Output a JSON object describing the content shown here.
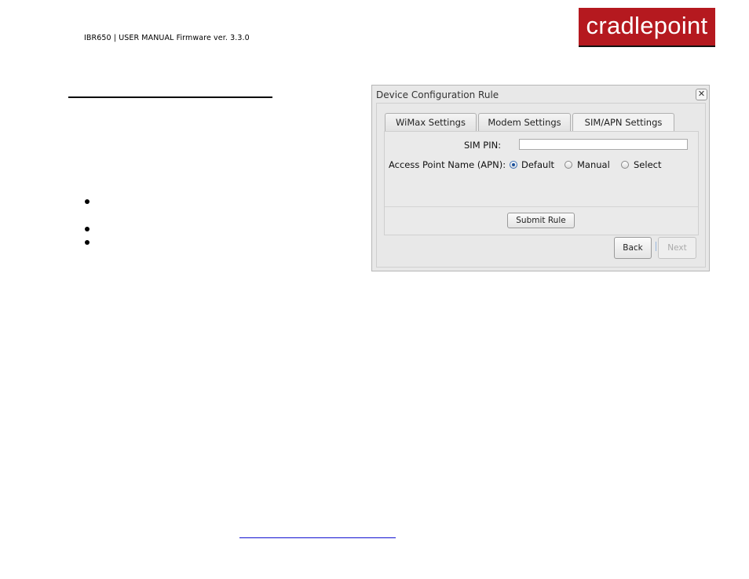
{
  "page_header": {
    "manual_title": "IBR650 | USER MANUAL Firmware ver. 3.3.0",
    "logo_text": "cradlepoint",
    "brand_color": "#b5191f"
  },
  "body": {
    "bullets": [
      "",
      "",
      ""
    ]
  },
  "dialog": {
    "title": "Device Configuration Rule",
    "close_icon": "close-icon",
    "tabs": [
      {
        "label": "WiMax Settings",
        "active": false
      },
      {
        "label": "Modem Settings",
        "active": false
      },
      {
        "label": "SIM/APN Settings",
        "active": true
      }
    ],
    "sim_pin": {
      "label": "SIM PIN:",
      "value": ""
    },
    "apn": {
      "label": "Access Point Name (APN):",
      "options": [
        {
          "label": "Default",
          "checked": true
        },
        {
          "label": "Manual",
          "checked": false
        },
        {
          "label": "Select",
          "checked": false
        }
      ]
    },
    "submit_label": "Submit Rule",
    "back_label": "Back",
    "next_label": "Next"
  }
}
